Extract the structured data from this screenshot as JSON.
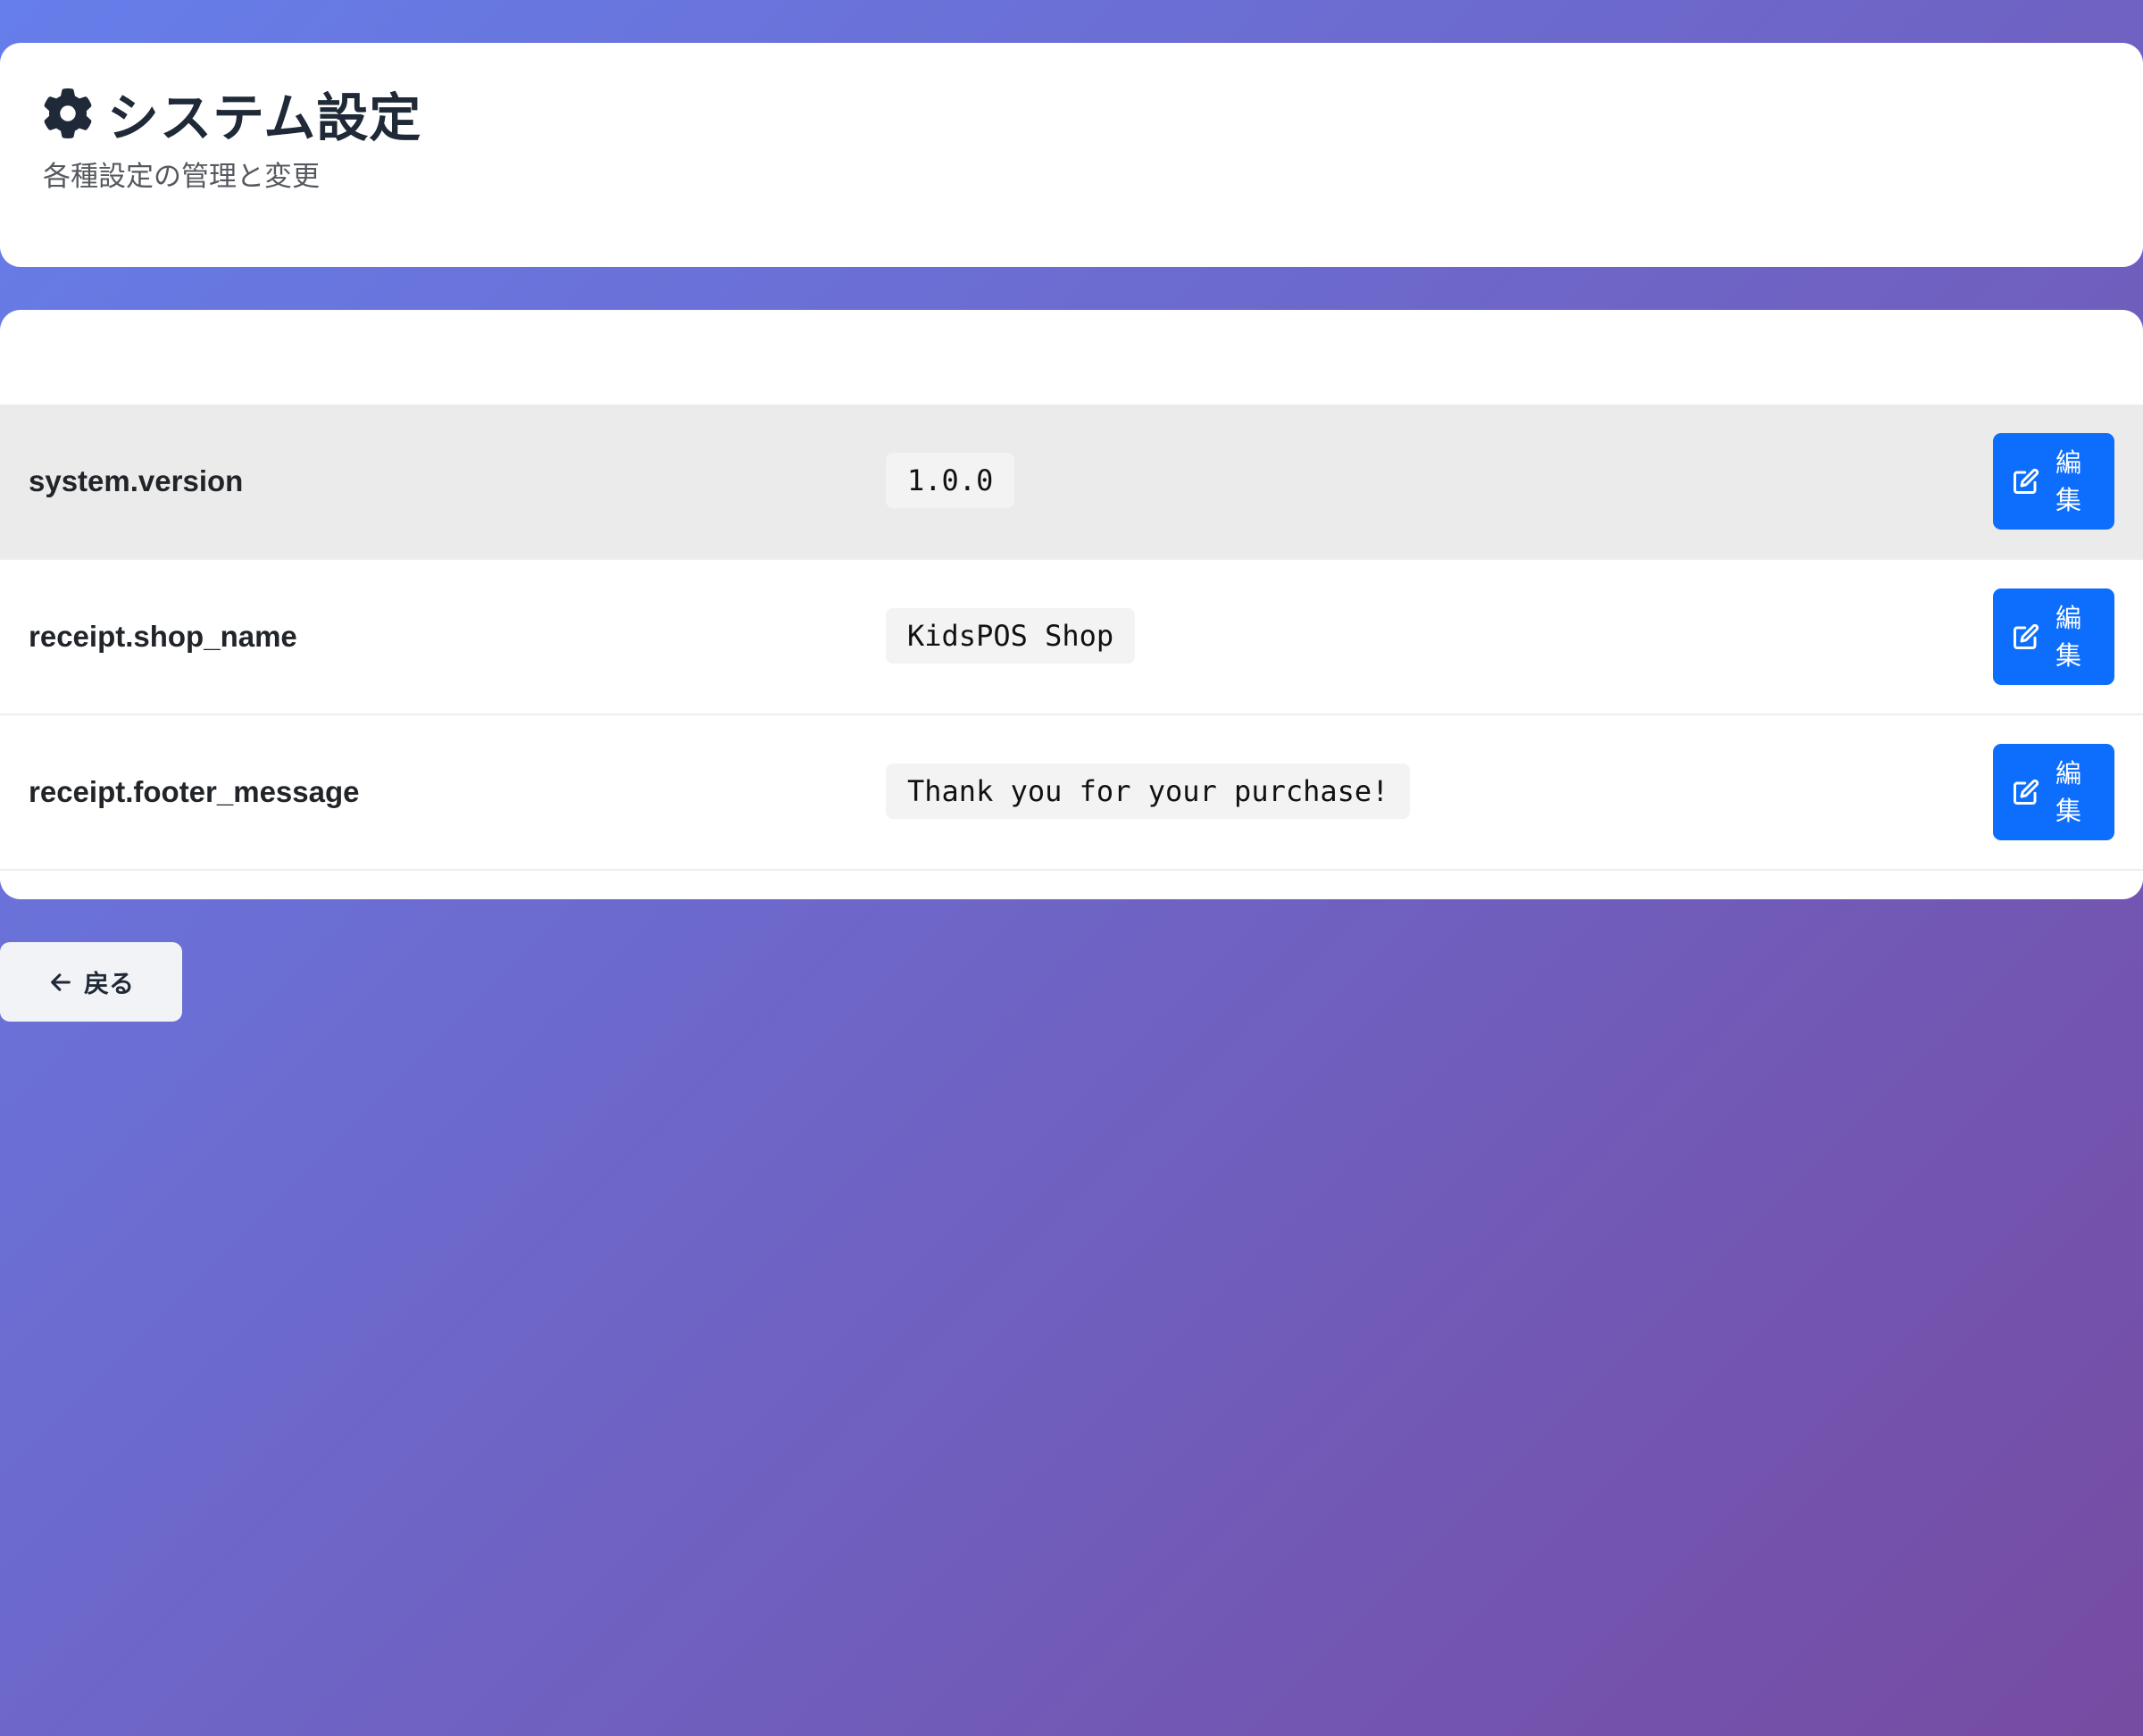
{
  "header": {
    "title": "システム設定",
    "subtitle": "各種設定の管理と変更",
    "icon": "gear-icon"
  },
  "settings": [
    {
      "key": "system.version",
      "value": "1.0.0",
      "edit_label": "編集",
      "highlighted": true
    },
    {
      "key": "receipt.shop_name",
      "value": "KidsPOS Shop",
      "edit_label": "編集",
      "highlighted": false
    },
    {
      "key": "receipt.footer_message",
      "value": "Thank you for your purchase!",
      "edit_label": "編集",
      "highlighted": false
    }
  ],
  "back_button": {
    "label": "戻る",
    "icon": "arrow-left-icon"
  },
  "colors": {
    "background_start": "#667eea",
    "background_end": "#764ba2",
    "primary": "#0d6efd",
    "highlight_row": "#ebebeb"
  }
}
